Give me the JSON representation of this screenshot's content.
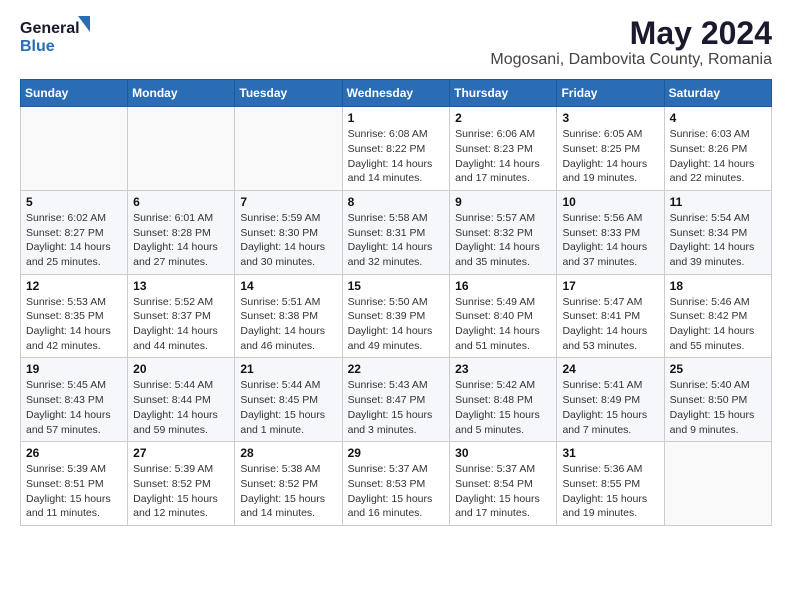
{
  "logo": {
    "general": "General",
    "blue": "Blue"
  },
  "title": "May 2024",
  "subtitle": "Mogosani, Dambovita County, Romania",
  "days_of_week": [
    "Sunday",
    "Monday",
    "Tuesday",
    "Wednesday",
    "Thursday",
    "Friday",
    "Saturday"
  ],
  "weeks": [
    [
      {
        "day": "",
        "info": ""
      },
      {
        "day": "",
        "info": ""
      },
      {
        "day": "",
        "info": ""
      },
      {
        "day": "1",
        "info": "Sunrise: 6:08 AM\nSunset: 8:22 PM\nDaylight: 14 hours and 14 minutes."
      },
      {
        "day": "2",
        "info": "Sunrise: 6:06 AM\nSunset: 8:23 PM\nDaylight: 14 hours and 17 minutes."
      },
      {
        "day": "3",
        "info": "Sunrise: 6:05 AM\nSunset: 8:25 PM\nDaylight: 14 hours and 19 minutes."
      },
      {
        "day": "4",
        "info": "Sunrise: 6:03 AM\nSunset: 8:26 PM\nDaylight: 14 hours and 22 minutes."
      }
    ],
    [
      {
        "day": "5",
        "info": "Sunrise: 6:02 AM\nSunset: 8:27 PM\nDaylight: 14 hours and 25 minutes."
      },
      {
        "day": "6",
        "info": "Sunrise: 6:01 AM\nSunset: 8:28 PM\nDaylight: 14 hours and 27 minutes."
      },
      {
        "day": "7",
        "info": "Sunrise: 5:59 AM\nSunset: 8:30 PM\nDaylight: 14 hours and 30 minutes."
      },
      {
        "day": "8",
        "info": "Sunrise: 5:58 AM\nSunset: 8:31 PM\nDaylight: 14 hours and 32 minutes."
      },
      {
        "day": "9",
        "info": "Sunrise: 5:57 AM\nSunset: 8:32 PM\nDaylight: 14 hours and 35 minutes."
      },
      {
        "day": "10",
        "info": "Sunrise: 5:56 AM\nSunset: 8:33 PM\nDaylight: 14 hours and 37 minutes."
      },
      {
        "day": "11",
        "info": "Sunrise: 5:54 AM\nSunset: 8:34 PM\nDaylight: 14 hours and 39 minutes."
      }
    ],
    [
      {
        "day": "12",
        "info": "Sunrise: 5:53 AM\nSunset: 8:35 PM\nDaylight: 14 hours and 42 minutes."
      },
      {
        "day": "13",
        "info": "Sunrise: 5:52 AM\nSunset: 8:37 PM\nDaylight: 14 hours and 44 minutes."
      },
      {
        "day": "14",
        "info": "Sunrise: 5:51 AM\nSunset: 8:38 PM\nDaylight: 14 hours and 46 minutes."
      },
      {
        "day": "15",
        "info": "Sunrise: 5:50 AM\nSunset: 8:39 PM\nDaylight: 14 hours and 49 minutes."
      },
      {
        "day": "16",
        "info": "Sunrise: 5:49 AM\nSunset: 8:40 PM\nDaylight: 14 hours and 51 minutes."
      },
      {
        "day": "17",
        "info": "Sunrise: 5:47 AM\nSunset: 8:41 PM\nDaylight: 14 hours and 53 minutes."
      },
      {
        "day": "18",
        "info": "Sunrise: 5:46 AM\nSunset: 8:42 PM\nDaylight: 14 hours and 55 minutes."
      }
    ],
    [
      {
        "day": "19",
        "info": "Sunrise: 5:45 AM\nSunset: 8:43 PM\nDaylight: 14 hours and 57 minutes."
      },
      {
        "day": "20",
        "info": "Sunrise: 5:44 AM\nSunset: 8:44 PM\nDaylight: 14 hours and 59 minutes."
      },
      {
        "day": "21",
        "info": "Sunrise: 5:44 AM\nSunset: 8:45 PM\nDaylight: 15 hours and 1 minute."
      },
      {
        "day": "22",
        "info": "Sunrise: 5:43 AM\nSunset: 8:47 PM\nDaylight: 15 hours and 3 minutes."
      },
      {
        "day": "23",
        "info": "Sunrise: 5:42 AM\nSunset: 8:48 PM\nDaylight: 15 hours and 5 minutes."
      },
      {
        "day": "24",
        "info": "Sunrise: 5:41 AM\nSunset: 8:49 PM\nDaylight: 15 hours and 7 minutes."
      },
      {
        "day": "25",
        "info": "Sunrise: 5:40 AM\nSunset: 8:50 PM\nDaylight: 15 hours and 9 minutes."
      }
    ],
    [
      {
        "day": "26",
        "info": "Sunrise: 5:39 AM\nSunset: 8:51 PM\nDaylight: 15 hours and 11 minutes."
      },
      {
        "day": "27",
        "info": "Sunrise: 5:39 AM\nSunset: 8:52 PM\nDaylight: 15 hours and 12 minutes."
      },
      {
        "day": "28",
        "info": "Sunrise: 5:38 AM\nSunset: 8:52 PM\nDaylight: 15 hours and 14 minutes."
      },
      {
        "day": "29",
        "info": "Sunrise: 5:37 AM\nSunset: 8:53 PM\nDaylight: 15 hours and 16 minutes."
      },
      {
        "day": "30",
        "info": "Sunrise: 5:37 AM\nSunset: 8:54 PM\nDaylight: 15 hours and 17 minutes."
      },
      {
        "day": "31",
        "info": "Sunrise: 5:36 AM\nSunset: 8:55 PM\nDaylight: 15 hours and 19 minutes."
      },
      {
        "day": "",
        "info": ""
      }
    ]
  ]
}
